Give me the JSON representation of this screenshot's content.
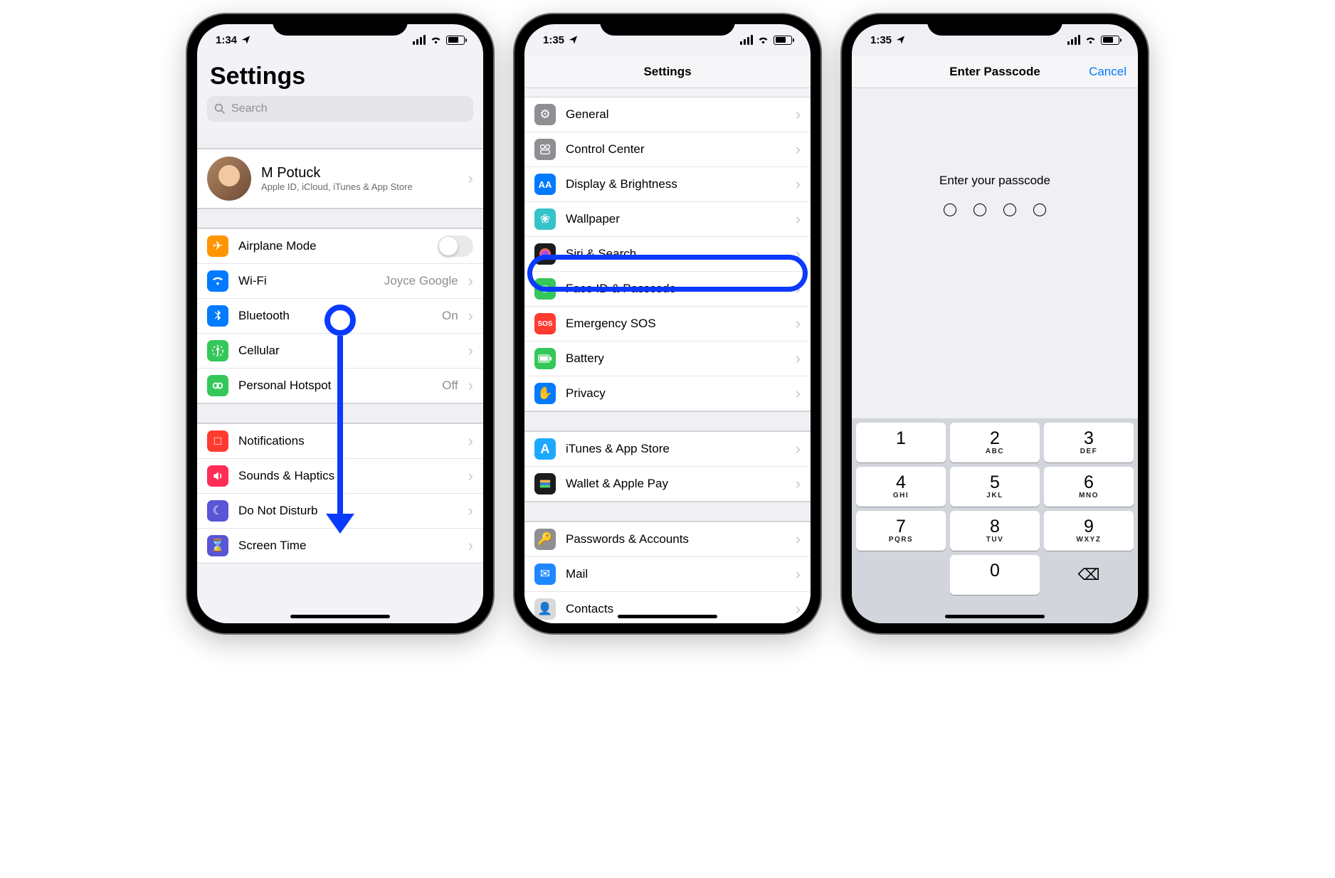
{
  "screens": {
    "settings1": {
      "status_time": "1:34",
      "title": "Settings",
      "search_placeholder": "Search",
      "profile": {
        "name": "M Potuck",
        "subtitle": "Apple ID, iCloud, iTunes & App Store"
      },
      "group1": [
        {
          "icon": "airplane",
          "label": "Airplane Mode",
          "control": "toggle",
          "value": "off"
        },
        {
          "icon": "wifi",
          "label": "Wi-Fi",
          "value": "Joyce Google"
        },
        {
          "icon": "bluetooth",
          "label": "Bluetooth",
          "value": "On"
        },
        {
          "icon": "cellular",
          "label": "Cellular",
          "value": ""
        },
        {
          "icon": "hotspot",
          "label": "Personal Hotspot",
          "value": "Off"
        }
      ],
      "group2": [
        {
          "icon": "notif",
          "label": "Notifications"
        },
        {
          "icon": "sounds",
          "label": "Sounds & Haptics"
        },
        {
          "icon": "dnd",
          "label": "Do Not Disturb"
        },
        {
          "icon": "screentime",
          "label": "Screen Time"
        }
      ]
    },
    "settings2": {
      "status_time": "1:35",
      "nav_title": "Settings",
      "groupA": [
        {
          "icon": "general",
          "label": "General"
        },
        {
          "icon": "cc",
          "label": "Control Center"
        },
        {
          "icon": "display",
          "label": "Display & Brightness"
        },
        {
          "icon": "wallpaper",
          "label": "Wallpaper"
        },
        {
          "icon": "siri",
          "label": "Siri & Search"
        },
        {
          "icon": "faceid",
          "label": "Face ID & Passcode",
          "highlight": true
        },
        {
          "icon": "sos",
          "label": "Emergency SOS"
        },
        {
          "icon": "battery",
          "label": "Battery"
        },
        {
          "icon": "privacy",
          "label": "Privacy"
        }
      ],
      "groupB": [
        {
          "icon": "itunes",
          "label": "iTunes & App Store"
        },
        {
          "icon": "wallet",
          "label": "Wallet & Apple Pay"
        }
      ],
      "groupC": [
        {
          "icon": "passwords",
          "label": "Passwords & Accounts"
        },
        {
          "icon": "mail",
          "label": "Mail"
        },
        {
          "icon": "contacts",
          "label": "Contacts"
        }
      ]
    },
    "passcode": {
      "status_time": "1:35",
      "nav_title": "Enter Passcode",
      "cancel": "Cancel",
      "prompt": "Enter your passcode",
      "dots": 4,
      "keypad": [
        {
          "digit": "1",
          "letters": ""
        },
        {
          "digit": "2",
          "letters": "ABC"
        },
        {
          "digit": "3",
          "letters": "DEF"
        },
        {
          "digit": "4",
          "letters": "GHI"
        },
        {
          "digit": "5",
          "letters": "JKL"
        },
        {
          "digit": "6",
          "letters": "MNO"
        },
        {
          "digit": "7",
          "letters": "PQRS"
        },
        {
          "digit": "8",
          "letters": "TUV"
        },
        {
          "digit": "9",
          "letters": "WXYZ"
        },
        {
          "digit": "",
          "letters": "",
          "blank": true
        },
        {
          "digit": "0",
          "letters": ""
        },
        {
          "digit": "⌫",
          "letters": "",
          "delete": true
        }
      ]
    }
  },
  "icon_styles": {
    "airplane": {
      "bg": "#ff9500",
      "glyph": "✈"
    },
    "wifi": {
      "bg": "#007aff",
      "glyph": "wifi"
    },
    "bluetooth": {
      "bg": "#007aff",
      "glyph": "bt"
    },
    "cellular": {
      "bg": "#34c759",
      "glyph": "ant"
    },
    "hotspot": {
      "bg": "#34c759",
      "glyph": "link"
    },
    "notif": {
      "bg": "#ff3b30",
      "glyph": "□"
    },
    "sounds": {
      "bg": "#ff2d55",
      "glyph": "snd"
    },
    "dnd": {
      "bg": "#5856d6",
      "glyph": "☾"
    },
    "screentime": {
      "bg": "#5856d6",
      "glyph": "⌛"
    },
    "general": {
      "bg": "#8e8e93",
      "glyph": "⚙"
    },
    "cc": {
      "bg": "#8e8e93",
      "glyph": "cc"
    },
    "display": {
      "bg": "#007aff",
      "glyph": "AA"
    },
    "wallpaper": {
      "bg": "#35c2c9",
      "glyph": "❀"
    },
    "siri": {
      "bg": "#1c1c1e",
      "glyph": "siri"
    },
    "faceid": {
      "bg": "#34c759",
      "glyph": "☺"
    },
    "sos": {
      "bg": "#ff3b30",
      "glyph": "SOS"
    },
    "battery": {
      "bg": "#34c759",
      "glyph": "bat"
    },
    "privacy": {
      "bg": "#007aff",
      "glyph": "✋"
    },
    "itunes": {
      "bg": "#1da8ff",
      "glyph": "A"
    },
    "wallet": {
      "bg": "#1c1c1e",
      "glyph": "wal"
    },
    "passwords": {
      "bg": "#8e8e93",
      "glyph": "🔑"
    },
    "mail": {
      "bg": "#1e88ff",
      "glyph": "✉"
    },
    "contacts": {
      "bg": "#d9d9d9",
      "glyph": "👤"
    }
  }
}
